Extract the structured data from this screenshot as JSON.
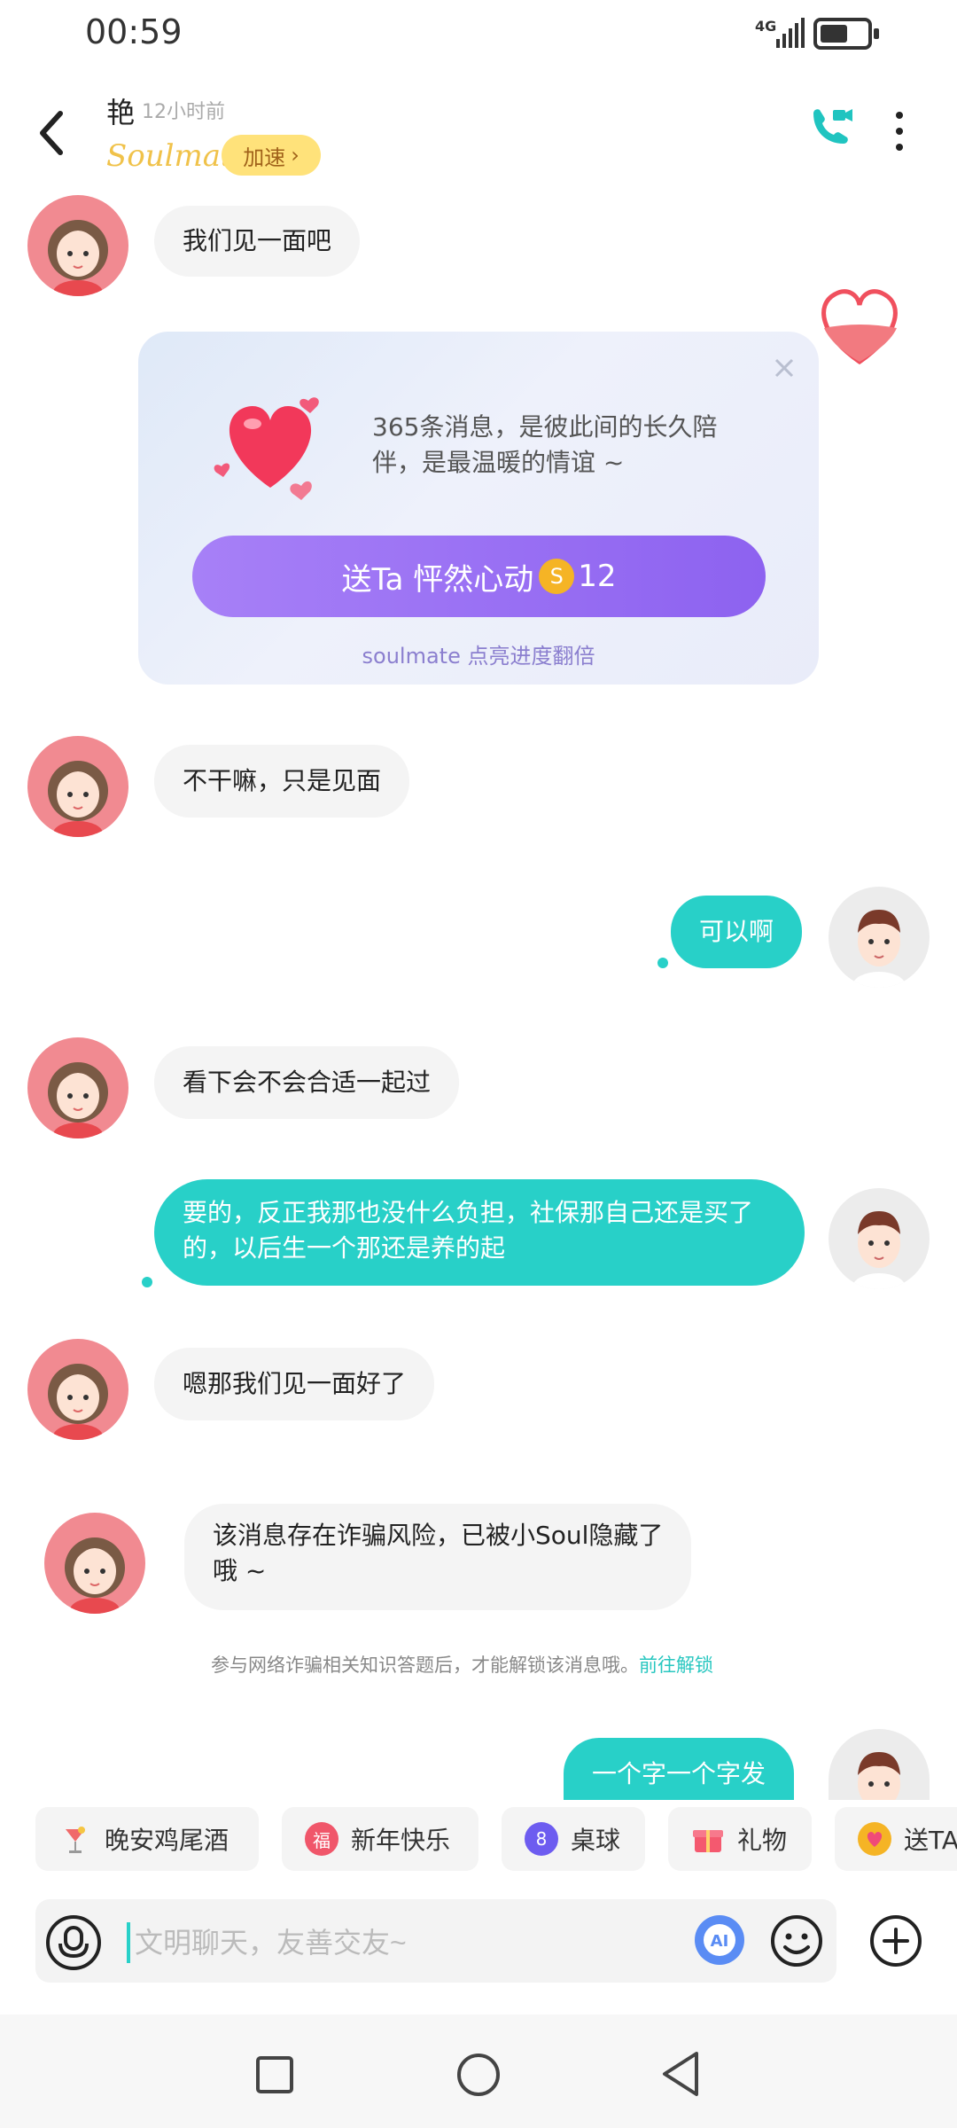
{
  "status_bar": {
    "time": "00:59",
    "network": "4G"
  },
  "header": {
    "name": "艳",
    "last_seen": "12小时前",
    "badge_logo": "Soulmate",
    "boost_label": "加速"
  },
  "messages": [
    {
      "side": "in",
      "text": "我们见一面吧"
    },
    {
      "side": "in",
      "text": "不干嘛，只是见面"
    },
    {
      "side": "out",
      "text": "可以啊"
    },
    {
      "side": "in",
      "text": "看下会不会合适一起过"
    },
    {
      "side": "out",
      "text": "要的，反正我那也没什么负担，社保那自己还是买了的，以后生一个那还是养的起"
    },
    {
      "side": "in",
      "text": "嗯那我们见一面好了"
    },
    {
      "side": "in",
      "text": "该消息存在诈骗风险，已被小Soul隐藏了哦 ~"
    },
    {
      "side": "out",
      "text": "一个字一个字发"
    }
  ],
  "gift_card": {
    "text": "365条消息，是彼此间的长久陪伴，是最温暖的情谊 ~",
    "button_prefix": "送Ta 怦然心动",
    "coin_symbol": "S",
    "button_price": "12",
    "subtext": "soulmate 点亮进度翻倍"
  },
  "fraud_notice": {
    "text": "参与网络诈骗相关知识答题后，才能解锁该消息哦。",
    "link": "前往解锁"
  },
  "quick_chips": [
    {
      "label": "晚安鸡尾酒",
      "icon": "cocktail-icon",
      "color": "#ffffff"
    },
    {
      "label": "新年快乐",
      "icon": "new-year-icon",
      "color": "#f0566a",
      "glyph": "福"
    },
    {
      "label": "桌球",
      "icon": "billiard-icon",
      "color": "#6d5cf0",
      "glyph": "8"
    },
    {
      "label": "礼物",
      "icon": "gift-icon",
      "color": "#f4596f"
    },
    {
      "label": "送TA",
      "icon": "send-heart-icon",
      "color": "#f5b425"
    }
  ],
  "input": {
    "placeholder": "文明聊天，友善交友~"
  }
}
